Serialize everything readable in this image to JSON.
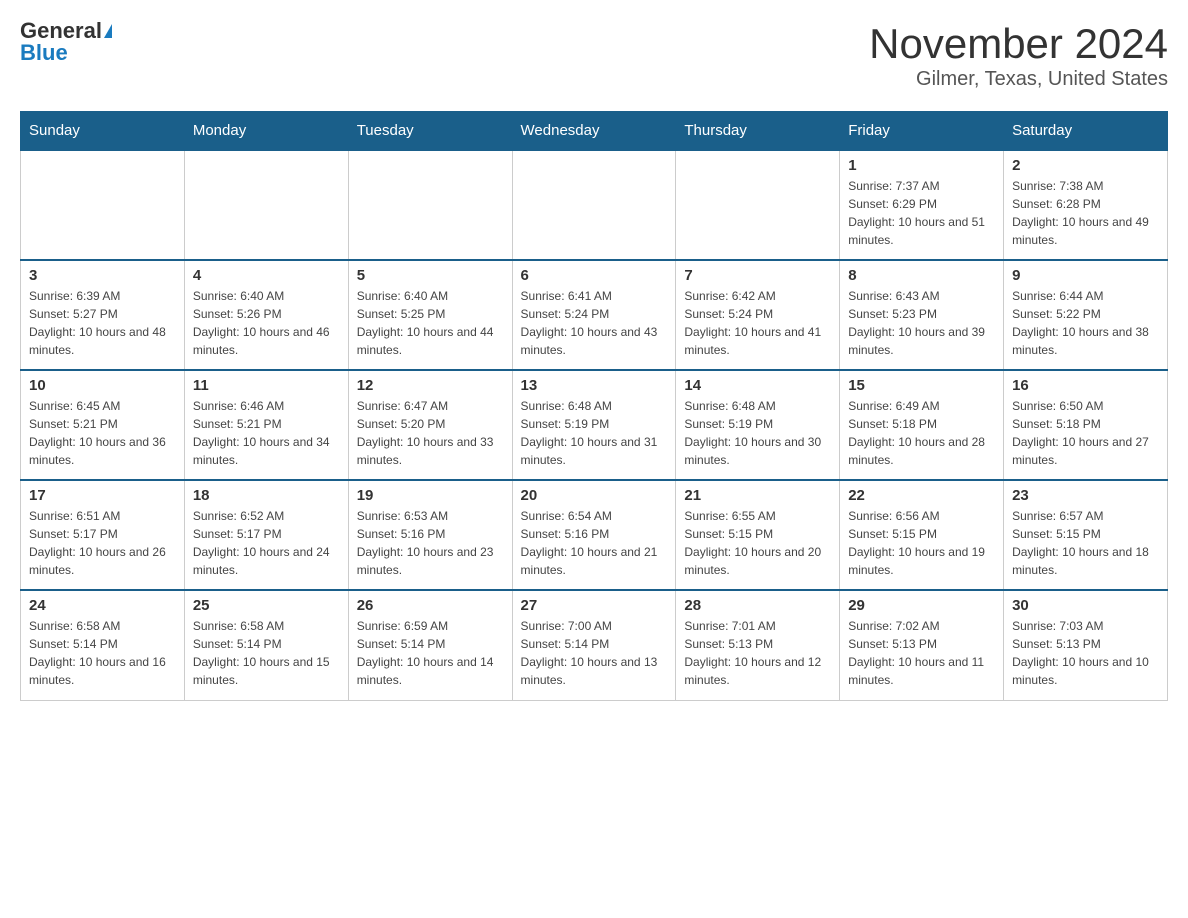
{
  "header": {
    "logo_general": "General",
    "logo_blue": "Blue",
    "title": "November 2024",
    "subtitle": "Gilmer, Texas, United States"
  },
  "days_of_week": [
    "Sunday",
    "Monday",
    "Tuesday",
    "Wednesday",
    "Thursday",
    "Friday",
    "Saturday"
  ],
  "weeks": [
    [
      {
        "day": "",
        "info": ""
      },
      {
        "day": "",
        "info": ""
      },
      {
        "day": "",
        "info": ""
      },
      {
        "day": "",
        "info": ""
      },
      {
        "day": "",
        "info": ""
      },
      {
        "day": "1",
        "info": "Sunrise: 7:37 AM\nSunset: 6:29 PM\nDaylight: 10 hours and 51 minutes."
      },
      {
        "day": "2",
        "info": "Sunrise: 7:38 AM\nSunset: 6:28 PM\nDaylight: 10 hours and 49 minutes."
      }
    ],
    [
      {
        "day": "3",
        "info": "Sunrise: 6:39 AM\nSunset: 5:27 PM\nDaylight: 10 hours and 48 minutes."
      },
      {
        "day": "4",
        "info": "Sunrise: 6:40 AM\nSunset: 5:26 PM\nDaylight: 10 hours and 46 minutes."
      },
      {
        "day": "5",
        "info": "Sunrise: 6:40 AM\nSunset: 5:25 PM\nDaylight: 10 hours and 44 minutes."
      },
      {
        "day": "6",
        "info": "Sunrise: 6:41 AM\nSunset: 5:24 PM\nDaylight: 10 hours and 43 minutes."
      },
      {
        "day": "7",
        "info": "Sunrise: 6:42 AM\nSunset: 5:24 PM\nDaylight: 10 hours and 41 minutes."
      },
      {
        "day": "8",
        "info": "Sunrise: 6:43 AM\nSunset: 5:23 PM\nDaylight: 10 hours and 39 minutes."
      },
      {
        "day": "9",
        "info": "Sunrise: 6:44 AM\nSunset: 5:22 PM\nDaylight: 10 hours and 38 minutes."
      }
    ],
    [
      {
        "day": "10",
        "info": "Sunrise: 6:45 AM\nSunset: 5:21 PM\nDaylight: 10 hours and 36 minutes."
      },
      {
        "day": "11",
        "info": "Sunrise: 6:46 AM\nSunset: 5:21 PM\nDaylight: 10 hours and 34 minutes."
      },
      {
        "day": "12",
        "info": "Sunrise: 6:47 AM\nSunset: 5:20 PM\nDaylight: 10 hours and 33 minutes."
      },
      {
        "day": "13",
        "info": "Sunrise: 6:48 AM\nSunset: 5:19 PM\nDaylight: 10 hours and 31 minutes."
      },
      {
        "day": "14",
        "info": "Sunrise: 6:48 AM\nSunset: 5:19 PM\nDaylight: 10 hours and 30 minutes."
      },
      {
        "day": "15",
        "info": "Sunrise: 6:49 AM\nSunset: 5:18 PM\nDaylight: 10 hours and 28 minutes."
      },
      {
        "day": "16",
        "info": "Sunrise: 6:50 AM\nSunset: 5:18 PM\nDaylight: 10 hours and 27 minutes."
      }
    ],
    [
      {
        "day": "17",
        "info": "Sunrise: 6:51 AM\nSunset: 5:17 PM\nDaylight: 10 hours and 26 minutes."
      },
      {
        "day": "18",
        "info": "Sunrise: 6:52 AM\nSunset: 5:17 PM\nDaylight: 10 hours and 24 minutes."
      },
      {
        "day": "19",
        "info": "Sunrise: 6:53 AM\nSunset: 5:16 PM\nDaylight: 10 hours and 23 minutes."
      },
      {
        "day": "20",
        "info": "Sunrise: 6:54 AM\nSunset: 5:16 PM\nDaylight: 10 hours and 21 minutes."
      },
      {
        "day": "21",
        "info": "Sunrise: 6:55 AM\nSunset: 5:15 PM\nDaylight: 10 hours and 20 minutes."
      },
      {
        "day": "22",
        "info": "Sunrise: 6:56 AM\nSunset: 5:15 PM\nDaylight: 10 hours and 19 minutes."
      },
      {
        "day": "23",
        "info": "Sunrise: 6:57 AM\nSunset: 5:15 PM\nDaylight: 10 hours and 18 minutes."
      }
    ],
    [
      {
        "day": "24",
        "info": "Sunrise: 6:58 AM\nSunset: 5:14 PM\nDaylight: 10 hours and 16 minutes."
      },
      {
        "day": "25",
        "info": "Sunrise: 6:58 AM\nSunset: 5:14 PM\nDaylight: 10 hours and 15 minutes."
      },
      {
        "day": "26",
        "info": "Sunrise: 6:59 AM\nSunset: 5:14 PM\nDaylight: 10 hours and 14 minutes."
      },
      {
        "day": "27",
        "info": "Sunrise: 7:00 AM\nSunset: 5:14 PM\nDaylight: 10 hours and 13 minutes."
      },
      {
        "day": "28",
        "info": "Sunrise: 7:01 AM\nSunset: 5:13 PM\nDaylight: 10 hours and 12 minutes."
      },
      {
        "day": "29",
        "info": "Sunrise: 7:02 AM\nSunset: 5:13 PM\nDaylight: 10 hours and 11 minutes."
      },
      {
        "day": "30",
        "info": "Sunrise: 7:03 AM\nSunset: 5:13 PM\nDaylight: 10 hours and 10 minutes."
      }
    ]
  ]
}
